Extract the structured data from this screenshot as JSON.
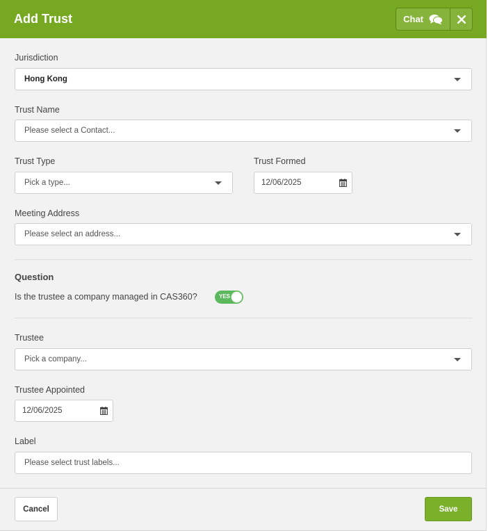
{
  "header": {
    "title": "Add Trust",
    "chat_label": "Chat",
    "chat_icon": "chat-bubbles-icon",
    "close_icon": "close-icon"
  },
  "form": {
    "jurisdiction": {
      "label": "Jurisdiction",
      "value": "Hong Kong"
    },
    "trust_name": {
      "label": "Trust Name",
      "placeholder": "Please select a Contact..."
    },
    "trust_type": {
      "label": "Trust Type",
      "placeholder": "Pick a type..."
    },
    "trust_formed": {
      "label": "Trust Formed",
      "value": "12/06/2025"
    },
    "meeting_address": {
      "label": "Meeting Address",
      "placeholder": "Please select an address..."
    },
    "question_section": {
      "title": "Question",
      "question": "Is the trustee a company managed in CAS360?",
      "toggle_label": "YES"
    },
    "trustee": {
      "label": "Trustee",
      "placeholder": "Pick a company..."
    },
    "trustee_appointed": {
      "label": "Trustee Appointed",
      "value": "12/06/2025"
    },
    "label_field": {
      "label": "Label",
      "placeholder": "Please select trust labels..."
    }
  },
  "footer": {
    "cancel_label": "Cancel",
    "save_label": "Save"
  },
  "colors": {
    "header_bg": "#76a822",
    "save_bg": "#7bb02a",
    "toggle_on": "#5cb85c"
  }
}
